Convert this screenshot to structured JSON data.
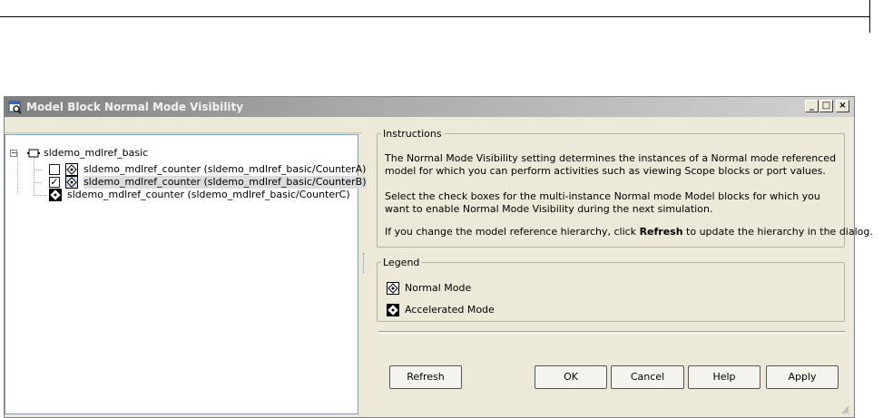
{
  "window": {
    "title": "Model Block Normal Mode Visibility",
    "controls": {
      "minimize": "_",
      "maximize": "□",
      "close": "×"
    }
  },
  "tree": {
    "root": {
      "label": "sldemo_mdlref_basic",
      "expanded": true
    },
    "children": [
      {
        "label": "sldemo_mdlref_counter (sldemo_mdlref_basic/CounterA)",
        "checked": false,
        "mode": "normal",
        "has_checkbox": true
      },
      {
        "label": "sldemo_mdlref_counter (sldemo_mdlref_basic/CounterB)",
        "checked": true,
        "mode": "normal",
        "has_checkbox": true,
        "selected": true
      },
      {
        "label": "sldemo_mdlref_counter (sldemo_mdlref_basic/CounterC)",
        "mode": "accelerated",
        "has_checkbox": false
      }
    ]
  },
  "instructions": {
    "legend": "Instructions",
    "para1": "The Normal Mode Visibility setting determines the instances of a Normal mode referenced model for which you can perform activities such as viewing Scope blocks or port values.",
    "para2": "Select the check boxes for the multi-instance Normal mode Model blocks for which you want to enable Normal Mode Visibility during the next simulation.",
    "para3_before": "If you change the model reference hierarchy, click ",
    "para3_bold": "Refresh",
    "para3_after": " to update the hierarchy in the dialog."
  },
  "legend": {
    "title": "Legend",
    "normal": "Normal Mode",
    "accelerated": "Accelerated Mode"
  },
  "buttons": {
    "refresh": "Refresh",
    "ok": "OK",
    "cancel": "Cancel",
    "help": "Help",
    "apply": "Apply"
  },
  "colors": {
    "titlebar_start": "#7f7f7f",
    "titlebar_end": "#d2d2d2",
    "dialog_bg": "#ece9d8",
    "selection": "#dcdcdc"
  }
}
